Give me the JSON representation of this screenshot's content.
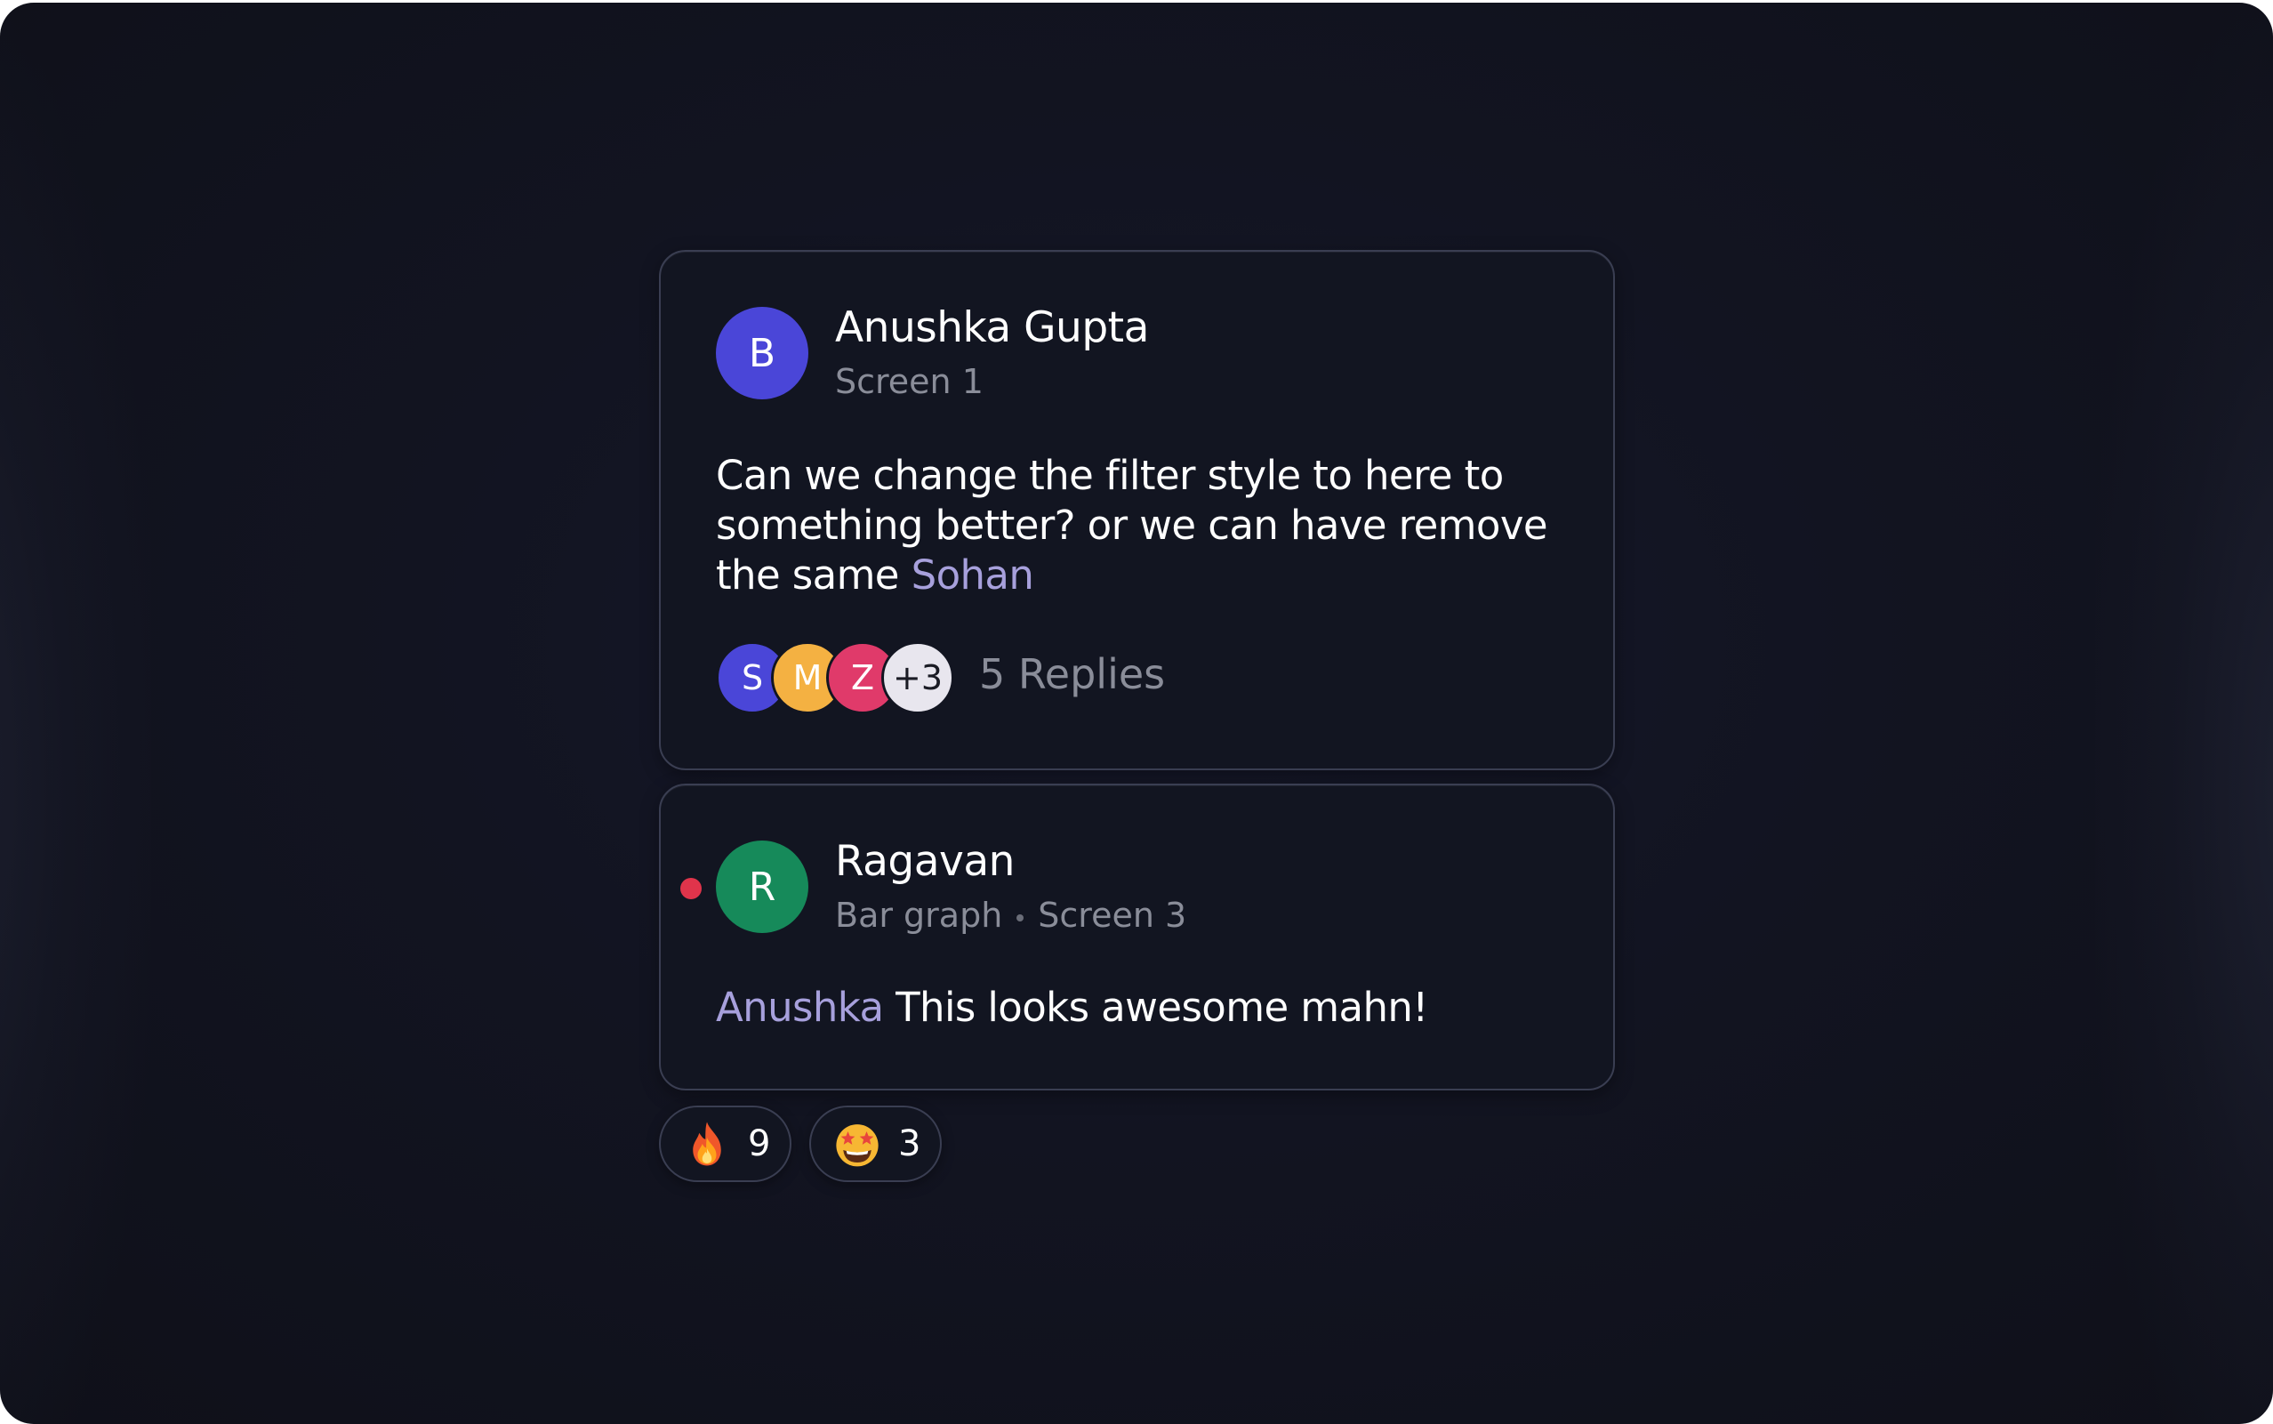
{
  "comments": [
    {
      "avatar_initial": "B",
      "avatar_color": "#4a46d8",
      "author": "Anushka Gupta",
      "location": "Screen 1",
      "text_lines": [
        "Can we change the filter style to here to",
        "something better? or we can have remove",
        "the same "
      ],
      "mention": "Sohan",
      "reply_avatars": [
        {
          "initial": "S",
          "color": "#4a46d8"
        },
        {
          "initial": "M",
          "color": "#f4b142"
        },
        {
          "initial": "Z",
          "color": "#e03a6a"
        },
        {
          "initial": "+3",
          "color": "#e8e6ee",
          "text_color": "#1a1b24"
        }
      ],
      "replies_label": "5 Replies"
    },
    {
      "avatar_initial": "R",
      "avatar_color": "#168a5a",
      "author": "Ragavan",
      "context": "Bar graph",
      "location": "Screen 3",
      "mention": "Anushka",
      "text": " This looks awesome mahn!",
      "unread": true
    }
  ],
  "reactions": [
    {
      "emoji": "fire-emoji",
      "count": "9"
    },
    {
      "emoji": "star-struck-emoji",
      "count": "3"
    }
  ],
  "colors": {
    "background": "#121421",
    "card": "#121521",
    "card_border": "#3a3e52",
    "mention": "#a7a0dc",
    "muted": "#8a8d99",
    "unread": "#e0344b"
  }
}
